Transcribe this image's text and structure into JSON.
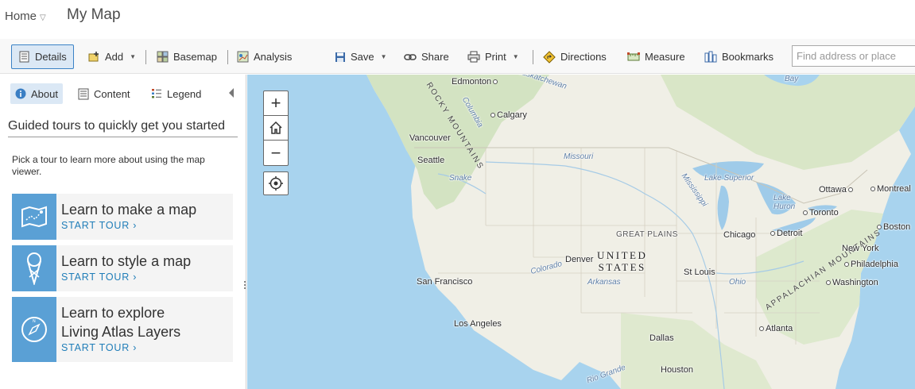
{
  "header": {
    "home_label": "Home",
    "map_title": "My Map"
  },
  "toolbar": {
    "details": "Details",
    "add": "Add",
    "basemap": "Basemap",
    "analysis": "Analysis",
    "save": "Save",
    "share": "Share",
    "print": "Print",
    "directions": "Directions",
    "measure": "Measure",
    "bookmarks": "Bookmarks",
    "search_placeholder": "Find address or place"
  },
  "panel": {
    "tabs": [
      {
        "label": "About"
      },
      {
        "label": "Content"
      },
      {
        "label": "Legend"
      }
    ],
    "heading": "Guided tours to quickly get you started",
    "intro": "Pick a tour to learn more about using the map viewer.",
    "tours": [
      {
        "title_line1": "Learn to make a map",
        "title_line2": "",
        "link": "START TOUR ›",
        "icon": "map-route-icon"
      },
      {
        "title_line1": "Learn to style a map",
        "title_line2": "",
        "link": "START TOUR ›",
        "icon": "style-pin-icon"
      },
      {
        "title_line1": "Learn to explore",
        "title_line2": "Living Atlas Layers",
        "link": "START TOUR ›",
        "icon": "compass-icon"
      }
    ]
  },
  "map": {
    "zoom_in": "+",
    "zoom_out": "−",
    "country": {
      "line1": "UNITED",
      "line2": "STATES"
    },
    "mountains": {
      "rocky": "ROCKY MOUNTAINS",
      "appalachian": "APPALACHIAN MOUNTAINS"
    },
    "regions": {
      "great_plains": "GREAT PLAINS"
    },
    "water": {
      "lake_superior": "Lake Superior",
      "lake_huron": "Lake\nHuron",
      "missouri": "Missouri",
      "mississippi": "Mississippi",
      "snake": "Snake",
      "colorado": "Colorado",
      "arkansas": "Arkansas",
      "ohio": "Ohio",
      "columbia": "Columbia",
      "rio_grande": "Rio Grande",
      "bay": "Bay",
      "saskatchewan": "Saskatchewan"
    },
    "cities": {
      "edmonton": "Edmonton",
      "calgary": "Calgary",
      "vancouver": "Vancouver",
      "seattle": "Seattle",
      "ottawa": "Ottawa",
      "montreal": "Montreal",
      "toronto": "Toronto",
      "boston": "Boston",
      "detroit": "Detroit",
      "chicago": "Chicago",
      "new_york": "New York",
      "philadelphia": "Philadelphia",
      "washington": "Washington",
      "denver": "Denver",
      "st_louis": "St Louis",
      "san_francisco": "San Francisco",
      "los_angeles": "Los Angeles",
      "atlanta": "Atlanta",
      "dallas": "Dallas",
      "houston": "Houston"
    },
    "colors": {
      "ocean": "#a8d3ee",
      "land": "#f0efe6",
      "forest": "#d3e3c2",
      "lake": "#9fcbe9",
      "border": "#c9c4b5"
    }
  }
}
